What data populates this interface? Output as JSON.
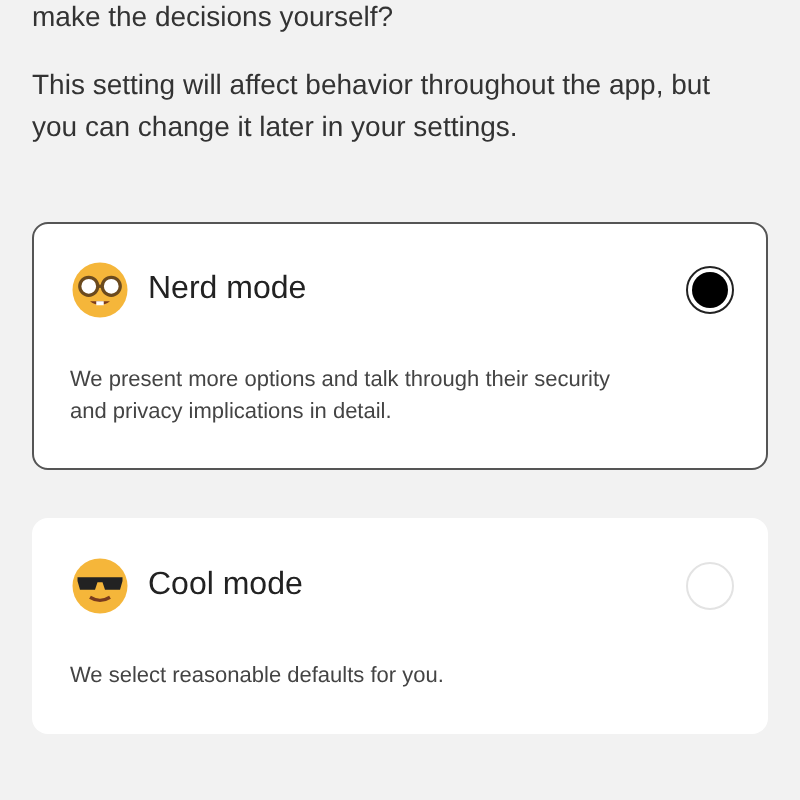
{
  "question_tail": "make the decisions yourself?",
  "note": "This setting will affect behavior throughout the app, but you can change it later in your settings.",
  "options": [
    {
      "kind": "nerd",
      "title": "Nerd mode",
      "description": "We present more options and talk through their security and privacy implications in detail.",
      "selected": true
    },
    {
      "kind": "cool",
      "title": "Cool mode",
      "description": "We select reasonable defaults for you.",
      "selected": false
    }
  ]
}
